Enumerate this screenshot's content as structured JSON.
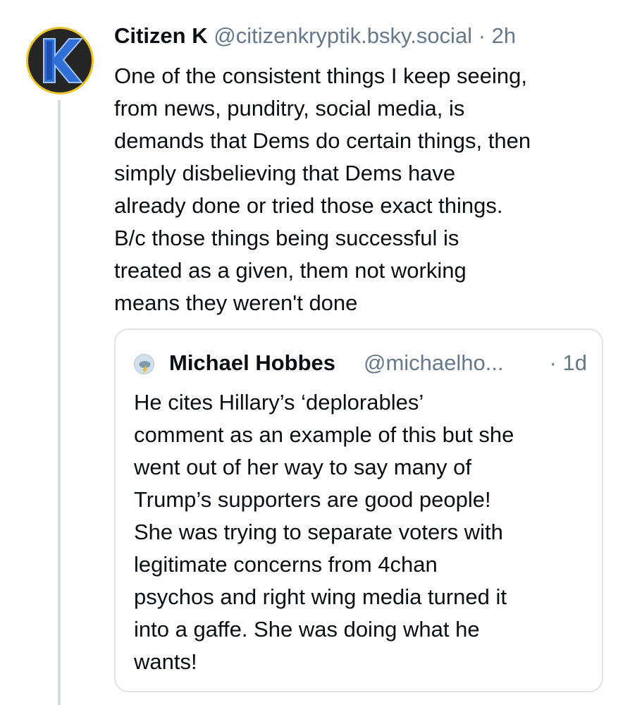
{
  "post": {
    "author_name": "Citizen K",
    "author_handle": "@citizenkryptik.bsky.social",
    "separator": "·",
    "time": "2h",
    "avatar_icon": "letter-k-logo",
    "text": "One of the consistent things I keep seeing,\nfrom news, punditry, social media, is\ndemands that Dems do certain things, then\nsimply disbelieving that Dems have\nalready done or tried those exact things.\nB/c those things being successful is\ntreated as a given, them not working\nmeans they weren't done"
  },
  "quote": {
    "author_name": "Michael Hobbes",
    "author_handle": "@michaelho...",
    "time": "· 1d",
    "avatar_icon": "storm-cloud-icon",
    "text": "He cites Hillary’s ‘deplorables’\ncomment as an example of this but she\nwent out of her way to say many of\nTrump’s supporters are good people!\nShe was trying to separate voters with\nlegitimate concerns from 4chan\npsychos and right wing media turned it\ninto a gaffe. She was doing what he\nwants!"
  },
  "colors": {
    "text": "#0b0f14",
    "muted": "#66788a",
    "avatar_ring": "#e8c32a",
    "avatar_letter": "#2f6fd6",
    "thread_line": "#d4dbe2",
    "quote_border": "#dfe4ea"
  }
}
